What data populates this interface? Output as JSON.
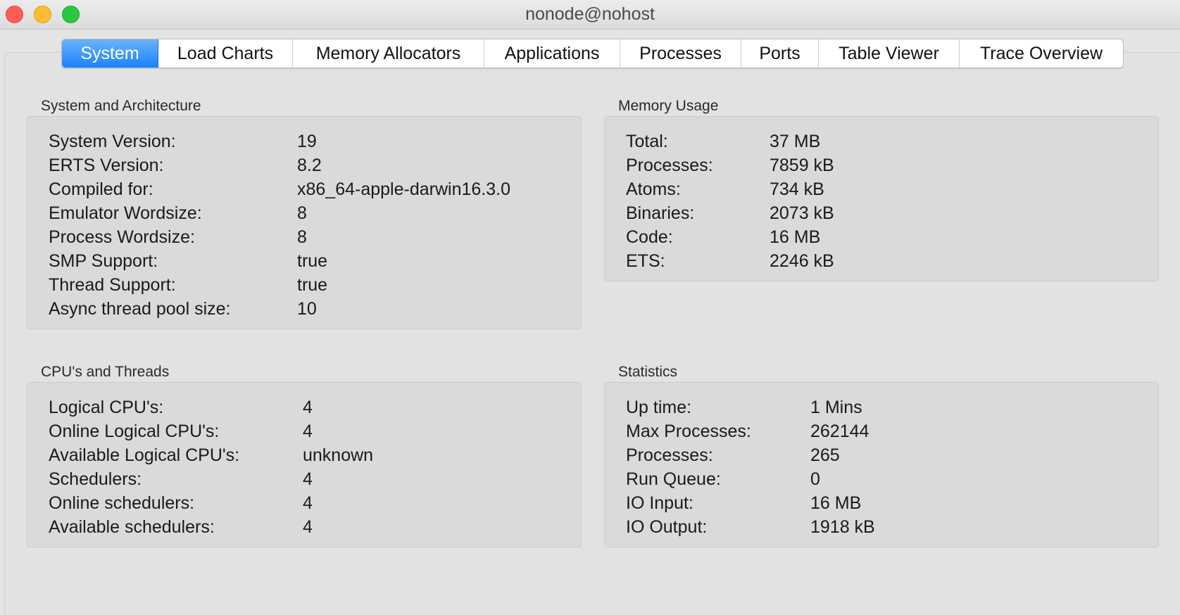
{
  "window": {
    "title": "nonode@nohost"
  },
  "tabs": [
    {
      "label": "System",
      "active": true
    },
    {
      "label": "Load Charts",
      "active": false
    },
    {
      "label": "Memory Allocators",
      "active": false
    },
    {
      "label": "Applications",
      "active": false
    },
    {
      "label": "Processes",
      "active": false
    },
    {
      "label": "Ports",
      "active": false
    },
    {
      "label": "Table Viewer",
      "active": false
    },
    {
      "label": "Trace Overview",
      "active": false
    }
  ],
  "colors": {
    "active_tab": "#1a82fb",
    "close": "#fd5f57",
    "minimize": "#febc2e",
    "maximize": "#28c840"
  },
  "system_arch": {
    "title": "System and Architecture",
    "rows": [
      {
        "label": "System Version:",
        "value": "19"
      },
      {
        "label": "ERTS Version:",
        "value": "8.2"
      },
      {
        "label": "Compiled for:",
        "value": "x86_64-apple-darwin16.3.0"
      },
      {
        "label": "Emulator Wordsize:",
        "value": "8"
      },
      {
        "label": "Process Wordsize:",
        "value": "8"
      },
      {
        "label": "SMP Support:",
        "value": "true"
      },
      {
        "label": "Thread Support:",
        "value": "true"
      },
      {
        "label": "Async thread pool size:",
        "value": "10"
      }
    ]
  },
  "memory_usage": {
    "title": "Memory Usage",
    "rows": [
      {
        "label": "Total:",
        "value": "37 MB"
      },
      {
        "label": "Processes:",
        "value": "7859 kB"
      },
      {
        "label": "Atoms:",
        "value": "734 kB"
      },
      {
        "label": "Binaries:",
        "value": "2073 kB"
      },
      {
        "label": "Code:",
        "value": "16 MB"
      },
      {
        "label": "ETS:",
        "value": "2246 kB"
      }
    ]
  },
  "cpu_threads": {
    "title": "CPU's and Threads",
    "rows": [
      {
        "label": "Logical CPU's:",
        "value": "4"
      },
      {
        "label": "Online Logical CPU's:",
        "value": "4"
      },
      {
        "label": "Available Logical CPU's:",
        "value": "unknown"
      },
      {
        "label": "Schedulers:",
        "value": "4"
      },
      {
        "label": "Online schedulers:",
        "value": "4"
      },
      {
        "label": "Available schedulers:",
        "value": "4"
      }
    ]
  },
  "statistics": {
    "title": "Statistics",
    "rows": [
      {
        "label": "Up time:",
        "value": "1 Mins"
      },
      {
        "label": "Max Processes:",
        "value": "262144"
      },
      {
        "label": "Processes:",
        "value": "265"
      },
      {
        "label": "Run Queue:",
        "value": "0"
      },
      {
        "label": "IO Input:",
        "value": "16 MB"
      },
      {
        "label": "IO Output:",
        "value": "1918 kB"
      }
    ]
  }
}
